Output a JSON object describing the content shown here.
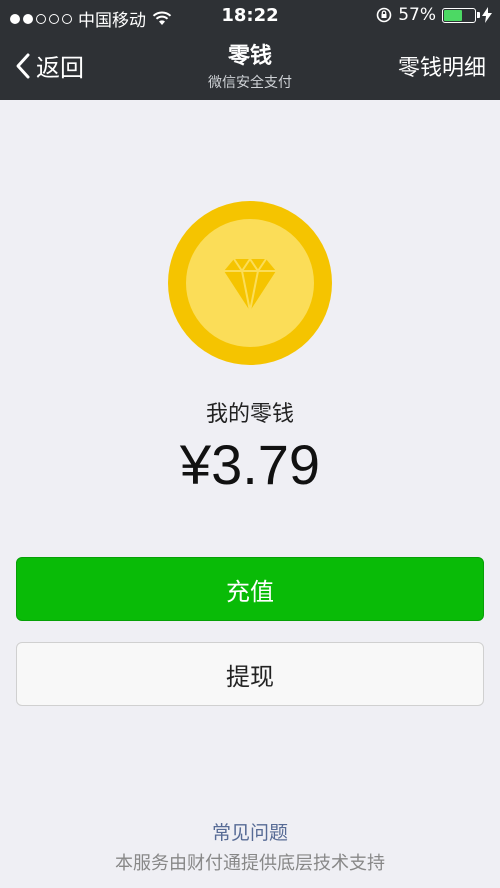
{
  "status_bar": {
    "carrier": "中国移动",
    "time": "18:22",
    "battery_percent": "57%",
    "battery_level": 0.57
  },
  "nav": {
    "back_label": "返回",
    "title": "零钱",
    "subtitle": "微信安全支付",
    "detail_label": "零钱明细"
  },
  "balance": {
    "label": "我的零钱",
    "amount": "¥3.79"
  },
  "actions": {
    "topup_label": "充值",
    "withdraw_label": "提现"
  },
  "footer": {
    "faq_label": "常见问题",
    "support_text": "本服务由财付通提供底层技术支持"
  },
  "colors": {
    "primary_button": "#09bb07",
    "coin_outer": "#f5c400",
    "coin_inner": "#fbdd58",
    "link": "#576b95"
  }
}
